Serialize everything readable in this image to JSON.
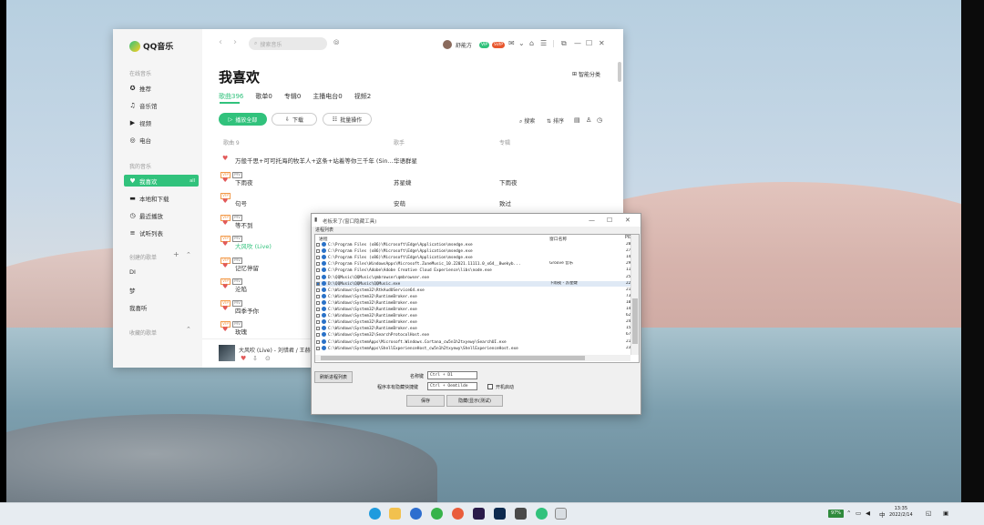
{
  "qq": {
    "logo": "QQ音乐",
    "sections": {
      "online": "在线音乐",
      "mine": "我的音乐",
      "created": "创建的歌单",
      "collected": "收藏的歌单"
    },
    "online_items": [
      {
        "label": "推荐",
        "icon": "compass-icon"
      },
      {
        "label": "音乐馆",
        "icon": "music-note-icon"
      },
      {
        "label": "视频",
        "icon": "video-icon"
      },
      {
        "label": "电台",
        "icon": "radio-icon"
      }
    ],
    "mine_items": [
      {
        "label": "我喜欢",
        "icon": "heart-icon",
        "badge": "all"
      },
      {
        "label": "本地和下载",
        "icon": "monitor-icon"
      },
      {
        "label": "最近播放",
        "icon": "clock-icon"
      },
      {
        "label": "试听列表",
        "icon": "list-icon"
      }
    ],
    "created_items": [
      "DI",
      "梦",
      "我喜听"
    ],
    "search_placeholder": "搜索音乐",
    "username": "舒能方",
    "vip_badges": [
      "VIP",
      "SVIP"
    ],
    "page_title": "我喜欢",
    "category_button": "智能分类",
    "tabs": [
      "歌曲396",
      "歌单0",
      "专辑0",
      "主播电台0",
      "视频2"
    ],
    "actions": {
      "play_all": "播放全部",
      "download": "下载",
      "batch": "批量操作"
    },
    "tools": {
      "search": "搜索",
      "sort": "排序"
    },
    "columns": {
      "title": "歌曲 9",
      "singer": "歌手",
      "album": "专辑"
    },
    "songs": [
      {
        "title": "万般千思+可可托海的牧羊人+这条+站着等你三千年 (Sin...",
        "singer": "华语群星",
        "album": "",
        "tags": []
      },
      {
        "title": "下雨夜",
        "singer": "苏星婕",
        "album": "下雨夜",
        "tags": [
          "VIP",
          "MV"
        ]
      },
      {
        "title": "句号",
        "singer": "安萌",
        "album": "致过",
        "tags": [
          "VIP"
        ]
      },
      {
        "title": "等不到",
        "singer": "",
        "album": "",
        "tags": [
          "VIP",
          "MV"
        ]
      },
      {
        "title": "大风吹 (Live)",
        "singer": "",
        "album": "",
        "tags": [
          "VIP",
          "MV"
        ],
        "playing": true
      },
      {
        "title": "记忆停留",
        "singer": "",
        "album": "",
        "tags": [
          "VIP",
          "MV"
        ]
      },
      {
        "title": "沦陷",
        "singer": "",
        "album": "",
        "tags": [
          "VIP",
          "MV"
        ]
      },
      {
        "title": "四季予你",
        "singer": "",
        "album": "",
        "tags": [
          "VIP",
          "MV"
        ]
      },
      {
        "title": "玫瑰",
        "singer": "",
        "album": "",
        "tags": [
          "VIP",
          "MV"
        ]
      }
    ],
    "now_playing": "大风吹 (Live) - 刘惜君 / 王赫"
  },
  "dialog": {
    "title": "老板来了(窗口隐藏工具)",
    "group_label": "进程列表",
    "col_path": "进程",
    "col_title": "窗口名称",
    "col_pid": "PID",
    "processes": [
      {
        "path": "C:\\Program Files (x86)\\Microsoft\\Edge\\Application\\msedge.exe",
        "title": "",
        "pid": "20"
      },
      {
        "path": "C:\\Program Files (x86)\\Microsoft\\Edge\\Application\\msedge.exe",
        "title": "",
        "pid": "27"
      },
      {
        "path": "C:\\Program Files (x86)\\Microsoft\\Edge\\Application\\msedge.exe",
        "title": "",
        "pid": "14"
      },
      {
        "path": "C:\\Program Files\\WindowsApps\\Microsoft.ZuneMusic_10.22021.11111.0_x64__8wekyb...",
        "title": "Groove 音乐",
        "pid": "29"
      },
      {
        "path": "C:\\Program Files\\Adobe\\Adobe Creative Cloud Experience\\libs\\node.exe",
        "title": "",
        "pid": "11"
      },
      {
        "path": "D:\\QQMusic\\QQMusic\\qmbrowser\\qmbrowser.exe",
        "title": "",
        "pid": "25"
      },
      {
        "path": "D:\\QQMusic\\QQMusic\\QQMusic.exe",
        "title": "下雨夜 - 苏星婕",
        "pid": "22",
        "selected": true
      },
      {
        "path": "C:\\Windows\\System32\\RtkAudUService64.exe",
        "title": "",
        "pid": "21"
      },
      {
        "path": "C:\\Windows\\System32\\RuntimeBroker.exe",
        "title": "",
        "pid": "73"
      },
      {
        "path": "C:\\Windows\\System32\\RuntimeBroker.exe",
        "title": "",
        "pid": "10"
      },
      {
        "path": "C:\\Windows\\System32\\RuntimeBroker.exe",
        "title": "",
        "pid": "14"
      },
      {
        "path": "C:\\Windows\\System32\\RuntimeBroker.exe",
        "title": "",
        "pid": "62"
      },
      {
        "path": "C:\\Windows\\System32\\RuntimeBroker.exe",
        "title": "",
        "pid": "24"
      },
      {
        "path": "C:\\Windows\\System32\\RuntimeBroker.exe",
        "title": "",
        "pid": "15"
      },
      {
        "path": "C:\\Windows\\System32\\SearchProtocolHost.exe",
        "title": "",
        "pid": "67"
      },
      {
        "path": "C:\\Windows\\SystemApps\\Microsoft.Windows.Cortana_cw5n1h2txyewy\\SearchUI.exe",
        "title": "",
        "pid": "21"
      },
      {
        "path": "C:\\Windows\\SystemApps\\ShellExperienceHost_cw5n1h2txyewy\\ShellExperienceHost.exe",
        "title": "",
        "pid": "23"
      }
    ],
    "refresh_button": "刷新进程列表",
    "label_show": "名称键",
    "value_show": "Ctrl + D1",
    "label_hide": "程序本有隐藏快捷键",
    "value_hide": "Ctrl + Oemtilde",
    "checkbox_label": "开机启动",
    "save_button": "保存",
    "hide_button": "隐藏(显示(测试)"
  },
  "taskbar": {
    "battery": "97%",
    "ime": "中",
    "time": "13:35",
    "date": "2022/2/14"
  }
}
